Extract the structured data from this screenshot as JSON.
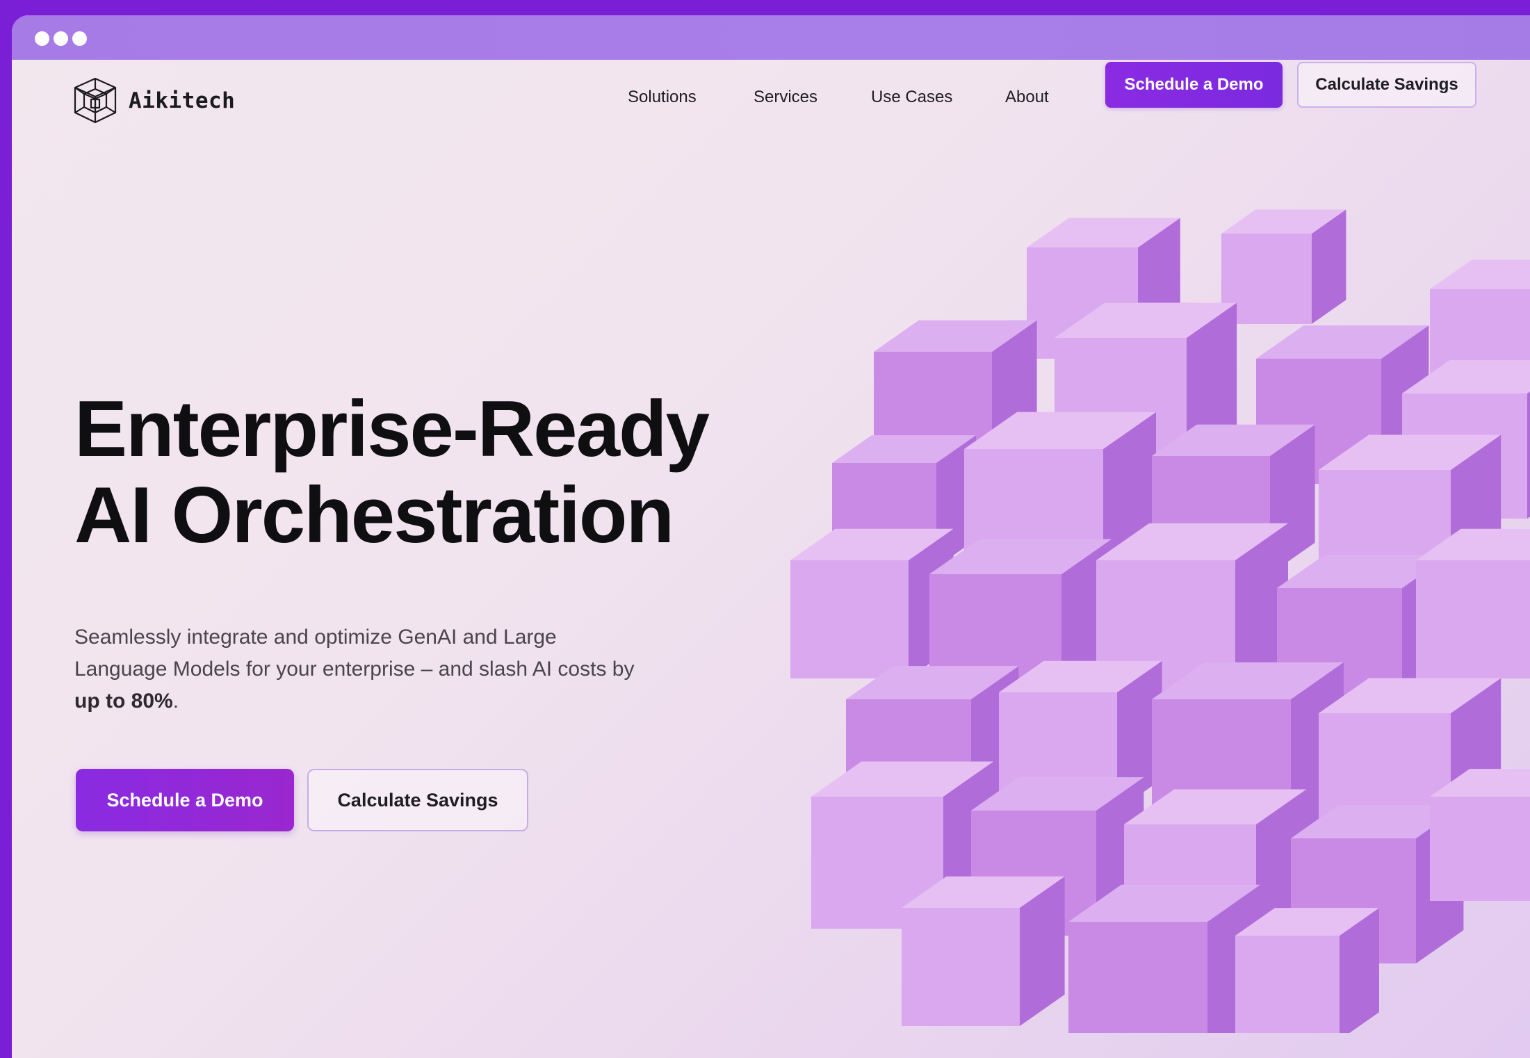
{
  "window": {
    "controls": [
      "close-dot",
      "minimize-dot",
      "maximize-dot"
    ]
  },
  "nav": {
    "logo_text": "Aikitech",
    "logo_icon": "cube-wireframe-icon",
    "links": [
      "Solutions",
      "Services",
      "Use Cases",
      "About"
    ],
    "cta_primary": "Schedule a Demo",
    "cta_secondary": "Calculate Savings"
  },
  "hero": {
    "title_line1": "Enterprise-Ready",
    "title_line2": "AI Orchestration",
    "subtitle_text": "Seamlessly integrate and optimize GenAI and Large Language Models for your enterprise – and slash AI costs by ",
    "subtitle_emphasis": "up to 80%",
    "subtitle_end": ".",
    "cta_primary": "Schedule a Demo",
    "cta_secondary": "Calculate Savings",
    "art_icon": "purple-cube-cluster-illustration"
  },
  "colors": {
    "outer_frame": "#7a1fd6",
    "chrome_bar": "#a77be6",
    "accent": "#8a2be2",
    "cube_light": "#d9a8ee",
    "cube_mid": "#c98ae5",
    "cube_dark": "#b06dd9"
  }
}
